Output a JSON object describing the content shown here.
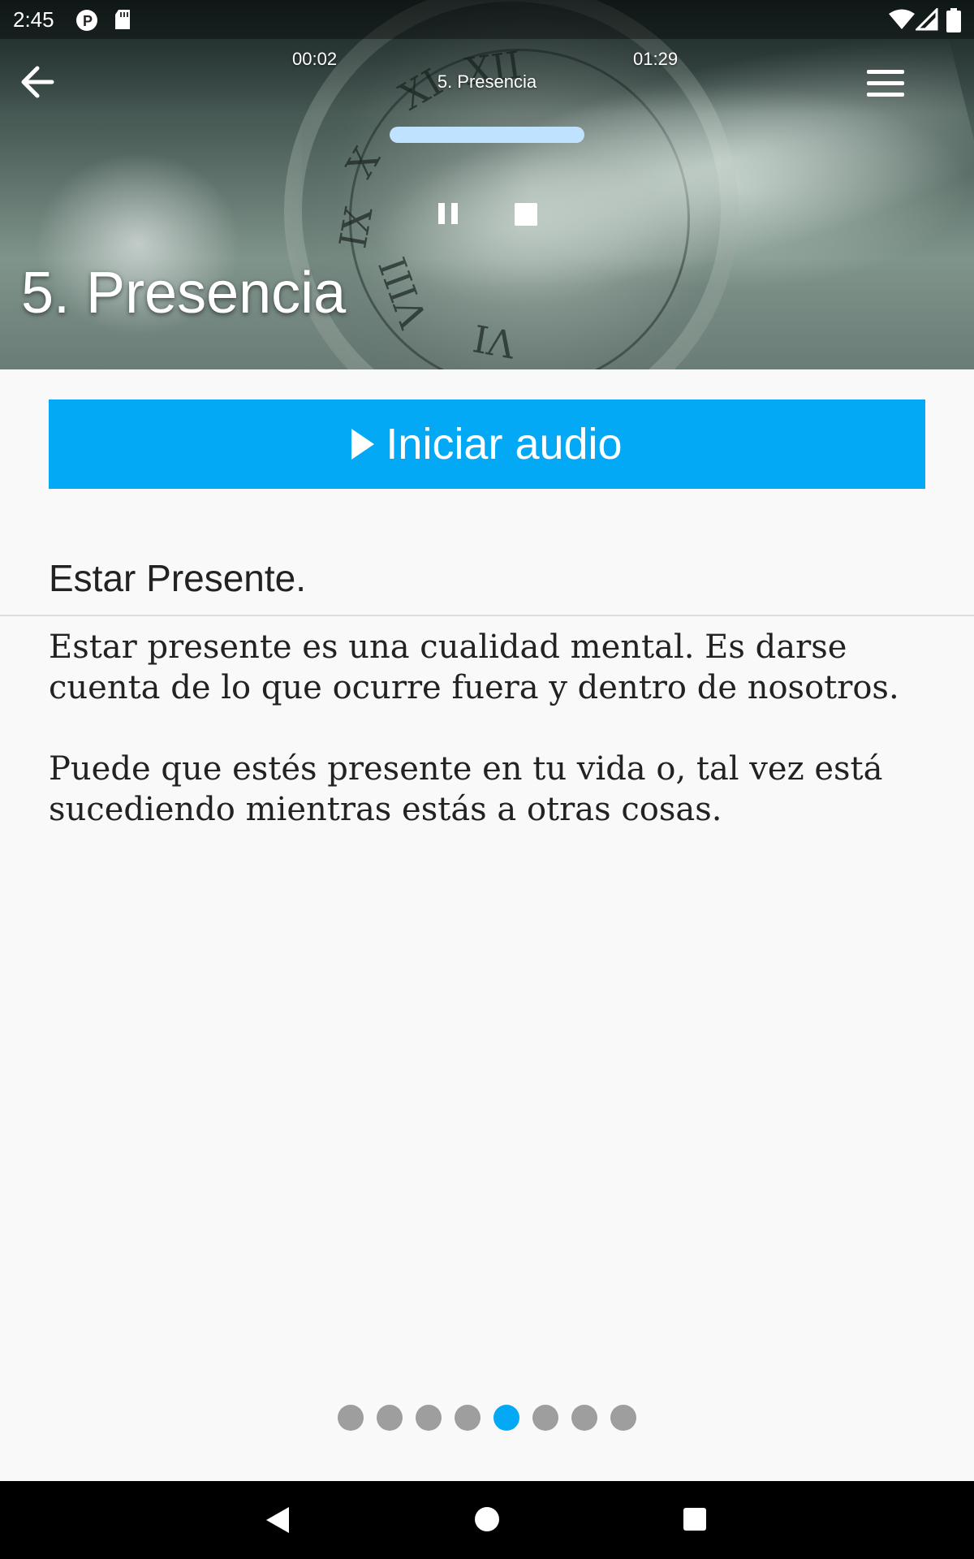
{
  "status_bar": {
    "time": "2:45",
    "icons": [
      "p-badge-icon",
      "sd-card-icon",
      "wifi-icon",
      "cell-signal-icon",
      "battery-icon"
    ]
  },
  "player": {
    "elapsed": "00:02",
    "total": "01:29",
    "track_title": "5. Presencia",
    "progress_fraction": 0.02,
    "icons": {
      "back": "arrow-left-icon",
      "menu": "hamburger-menu-icon",
      "pause": "pause-icon",
      "stop": "stop-icon"
    }
  },
  "hero": {
    "title": "5. Presencia"
  },
  "start_audio": {
    "label": "Iniciar audio",
    "icon": "play-icon",
    "color": "#03a9f4"
  },
  "content": {
    "heading": "Estar Presente.",
    "paragraphs": [
      "Estar presente es una cualidad mental. Es darse cuenta de lo que ocurre fuera y dentro de nosotros.",
      "Puede que estés presente en tu vida o, tal vez está sucediendo mientras estás a otras cosas."
    ]
  },
  "pager": {
    "total": 8,
    "active_index": 4,
    "active_color": "#03a9f4",
    "inactive_color": "#9e9e9e"
  },
  "nav_bar": {
    "icons": [
      "nav-back-icon",
      "nav-home-icon",
      "nav-recents-icon"
    ]
  }
}
